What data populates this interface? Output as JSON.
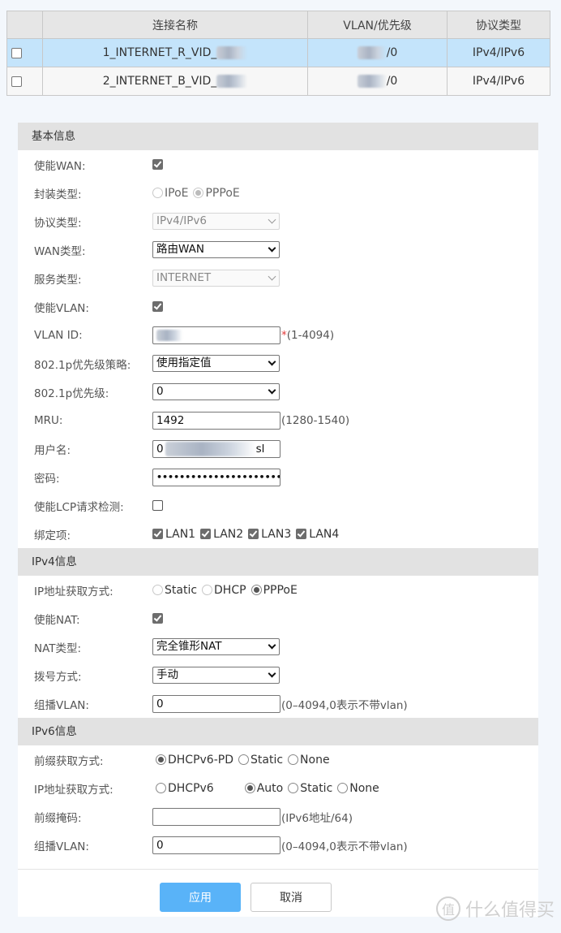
{
  "connections_table": {
    "headers": [
      "",
      "连接名称",
      "VLAN/优先级",
      "协议类型"
    ],
    "rows": [
      {
        "name": "1_INTERNET_R_VID_",
        "vlan_priority": "/0",
        "protocol": "IPv4/IPv6",
        "selected": true
      },
      {
        "name": "2_INTERNET_B_VID_",
        "vlan_priority": "/0",
        "protocol": "IPv4/IPv6",
        "selected": false
      }
    ]
  },
  "basic": {
    "title": "基本信息",
    "enable_wan": {
      "label": "使能WAN:",
      "checked": true
    },
    "encap": {
      "label": "封装类型:",
      "options": [
        "IPoE",
        "PPPoE"
      ],
      "selected": "PPPoE"
    },
    "protocol": {
      "label": "协议类型:",
      "value": "IPv4/IPv6"
    },
    "wan_type": {
      "label": "WAN类型:",
      "value": "路由WAN"
    },
    "service_type": {
      "label": "服务类型:",
      "value": "INTERNET"
    },
    "enable_vlan": {
      "label": "使能VLAN:",
      "checked": true
    },
    "vlan_id": {
      "label": "VLAN ID:",
      "required_mark": "*",
      "hint": "(1-4094)"
    },
    "priority_policy": {
      "label": "802.1p优先级策略:",
      "value": "使用指定值"
    },
    "priority": {
      "label": "802.1p优先级:",
      "value": "0"
    },
    "mru": {
      "label": "MRU:",
      "value": "1492",
      "hint": "(1280-1540)"
    },
    "username": {
      "label": "用户名:",
      "value_prefix": "0",
      "value_suffix": "sl"
    },
    "password": {
      "label": "密码:",
      "value": "•••••••••••••••••••••••••••"
    },
    "lcp": {
      "label": "使能LCP请求检测:",
      "checked": false
    },
    "bind": {
      "label": "绑定项:",
      "items": [
        "LAN1",
        "LAN2",
        "LAN3",
        "LAN4"
      ]
    }
  },
  "ipv4": {
    "title": "IPv4信息",
    "ip_mode": {
      "label": "IP地址获取方式:",
      "options": [
        "Static",
        "DHCP",
        "PPPoE"
      ],
      "selected": "PPPoE"
    },
    "enable_nat": {
      "label": "使能NAT:",
      "checked": true
    },
    "nat_type": {
      "label": "NAT类型:",
      "value": "完全锥形NAT"
    },
    "dial_mode": {
      "label": "拨号方式:",
      "value": "手动"
    },
    "mcast_vlan": {
      "label": "组播VLAN:",
      "value": "0",
      "hint": "(0–4094,0表示不带vlan)"
    }
  },
  "ipv6": {
    "title": "IPv6信息",
    "prefix_mode": {
      "label": "前缀获取方式:",
      "options": [
        "DHCPv6-PD",
        "Static",
        "None"
      ],
      "selected": "DHCPv6-PD"
    },
    "ip_mode": {
      "label": "IP地址获取方式:",
      "options": [
        "DHCPv6",
        "Auto",
        "Static",
        "None"
      ],
      "selected": "Auto"
    },
    "prefix_mask": {
      "label": "前缀掩码:",
      "value": "",
      "hint": "(IPv6地址/64)"
    },
    "mcast_vlan": {
      "label": "组播VLAN:",
      "value": "0",
      "hint": "(0–4094,0表示不带vlan)"
    }
  },
  "buttons": {
    "apply": "应用",
    "cancel": "取消"
  },
  "watermark": {
    "icon_char": "值",
    "text": "什么值得买"
  },
  "colors": {
    "accent": "#59b3f8",
    "row_selected": "#c4e4fb",
    "section_bg": "#e2e2e2",
    "page_bg": "#f3f7fc"
  }
}
